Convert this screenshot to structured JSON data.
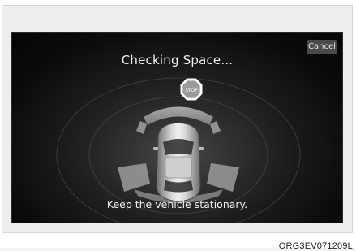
{
  "screen": {
    "title": "Checking Space...",
    "cancel_label": "Cancel",
    "message": "Keep the vehicle stationary.",
    "stop_sign_text": "STOP"
  },
  "figure": {
    "caption": "ORG3EV071209L"
  },
  "icons": {
    "stop": "stop-sign-icon",
    "vehicle": "car-top-view-icon"
  }
}
